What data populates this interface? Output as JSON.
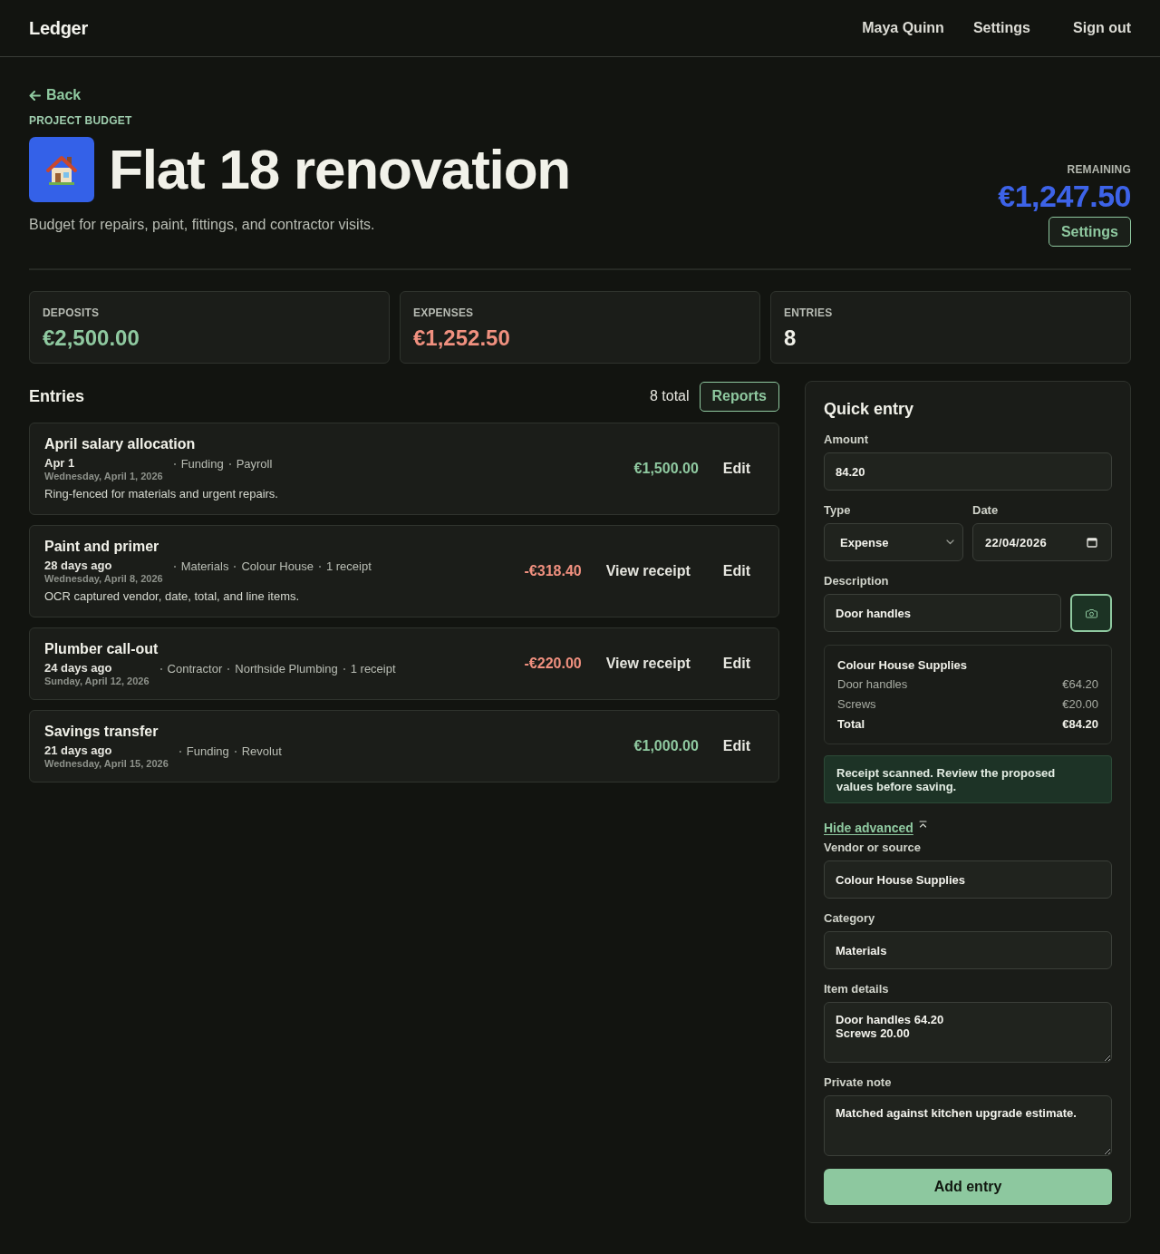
{
  "header": {
    "logo": "Ledger",
    "user": "Maya Quinn",
    "settings": "Settings",
    "sign_out": "Sign out"
  },
  "page": {
    "back": "Back",
    "eyebrow": "PROJECT BUDGET",
    "title": "Flat 18 renovation",
    "description": "Budget for repairs, paint, fittings, and contractor visits.",
    "remaining": {
      "label": "REMAINING",
      "amount": "€1,247.50"
    },
    "settings_button": "Settings"
  },
  "stats": [
    {
      "label": "DEPOSITS",
      "value": "€2,500.00",
      "kind": "deposit"
    },
    {
      "label": "EXPENSES",
      "value": "€1,252.50",
      "kind": "expense"
    },
    {
      "label": "ENTRIES",
      "value": "8",
      "kind": "count"
    }
  ],
  "entries": {
    "title": "Entries",
    "count": "8 total",
    "reports_button": "Reports",
    "items": [
      {
        "title": "April salary allocation",
        "when": "Apr 1",
        "date": "Wednesday, April 1, 2026",
        "meta": [
          "Funding",
          "Payroll"
        ],
        "note": "Ring-fenced for materials and urgent repairs.",
        "amount": "€1,500.00",
        "kind": "deposit",
        "edit_action": "Edit"
      },
      {
        "title": "Paint and primer",
        "when": "28 days ago",
        "date": "Wednesday, April 8, 2026",
        "meta": [
          "Materials",
          "Colour House",
          "1 receipt"
        ],
        "note": "OCR captured vendor, date, total, and line items.",
        "amount": "-€318.40",
        "kind": "expense",
        "receipt_action": "View receipt",
        "edit_action": "Edit"
      },
      {
        "title": "Plumber call-out",
        "when": "24 days ago",
        "date": "Sunday, April 12, 2026",
        "meta": [
          "Contractor",
          "Northside Plumbing",
          "1 receipt"
        ],
        "amount": "-€220.00",
        "kind": "expense",
        "receipt_action": "View receipt",
        "edit_action": "Edit"
      },
      {
        "title": "Savings transfer",
        "when": "21 days ago",
        "date": "Wednesday, April 15, 2026",
        "meta": [
          "Funding",
          "Revolut"
        ],
        "amount": "€1,000.00",
        "kind": "deposit",
        "edit_action": "Edit"
      }
    ]
  },
  "quick_entry": {
    "title": "Quick entry",
    "amount": {
      "label": "Amount",
      "value": "84.20"
    },
    "type": {
      "label": "Type",
      "value": "Expense"
    },
    "date": {
      "label": "Date",
      "value": "22/04/2026"
    },
    "description": {
      "label": "Description",
      "value": "Door handles"
    },
    "receipt": {
      "vendor": "Colour House Supplies",
      "lines": [
        {
          "label": "Door handles",
          "amount": "€64.20"
        },
        {
          "label": "Screws",
          "amount": "€20.00"
        }
      ],
      "total": {
        "label": "Total",
        "amount": "€84.20"
      }
    },
    "notice": "Receipt scanned. Review the proposed values before saving.",
    "advanced_toggle": {
      "label": "Hide advanced",
      "expanded": true
    },
    "advanced_fields": [
      {
        "label": "Vendor or source",
        "value": "Colour House Supplies",
        "kind": "input"
      },
      {
        "label": "Category",
        "value": "Materials",
        "kind": "input"
      },
      {
        "label": "Item details",
        "value": "Door handles 64.20\nScrews 20.00",
        "kind": "textarea"
      },
      {
        "label": "Private note",
        "value": "Matched against kitchen upgrade estimate.",
        "kind": "textarea"
      }
    ],
    "submit": "Add entry"
  }
}
